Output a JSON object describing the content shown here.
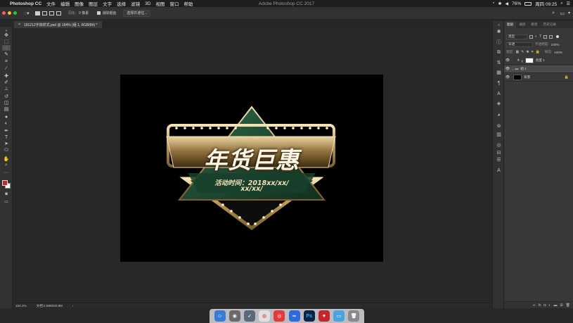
{
  "menubar": {
    "app_name": "Photoshop CC",
    "items": [
      "文件",
      "编辑",
      "图像",
      "图层",
      "文字",
      "选择",
      "滤镜",
      "3D",
      "视图",
      "窗口",
      "帮助"
    ],
    "window_title": "Adobe Photoshop CC 2017",
    "battery": "76%",
    "clock": "周四 09:25"
  },
  "options": {
    "feather_label": "羽化:",
    "feather_value": "0 像素",
    "antialias_label": "消除锯齿",
    "select_mask_label": "选择并遮住..."
  },
  "document_tab": {
    "title": "181212字体样式.psd @ 184% (组 1, RGB/8#) *",
    "close": "×"
  },
  "status": {
    "zoom": "184.2%",
    "doc_size": "文档:2.59M/20.8M",
    "arrow": "›"
  },
  "artwork": {
    "main_title": "年货巨惠",
    "event_line1": "活动时间：2018xx/xx/",
    "event_line2": "xx/xx/"
  },
  "panel": {
    "tabs": [
      "图层",
      "通道",
      "路径",
      "历史记录"
    ],
    "active_tab": "图层",
    "kind_label": "类型",
    "blend_mode": "穿透",
    "opacity_label": "不透明度:",
    "opacity_value": "100%",
    "lock_label": "锁定:",
    "fill_label": "填充:",
    "fill_value": "100%",
    "layers": [
      {
        "name": "亮度 1",
        "thumb_color": "#ffffff"
      },
      {
        "name": "组 1",
        "thumb_color": "#5a5a5a"
      },
      {
        "name": "背景",
        "thumb_color": "#000000"
      }
    ]
  },
  "dock": {
    "ps_label": "Ps"
  },
  "colors": {
    "gold": "#d8c08a",
    "green": "#1f4a33",
    "foreground": "#c0282a",
    "background": "#ffffff"
  }
}
